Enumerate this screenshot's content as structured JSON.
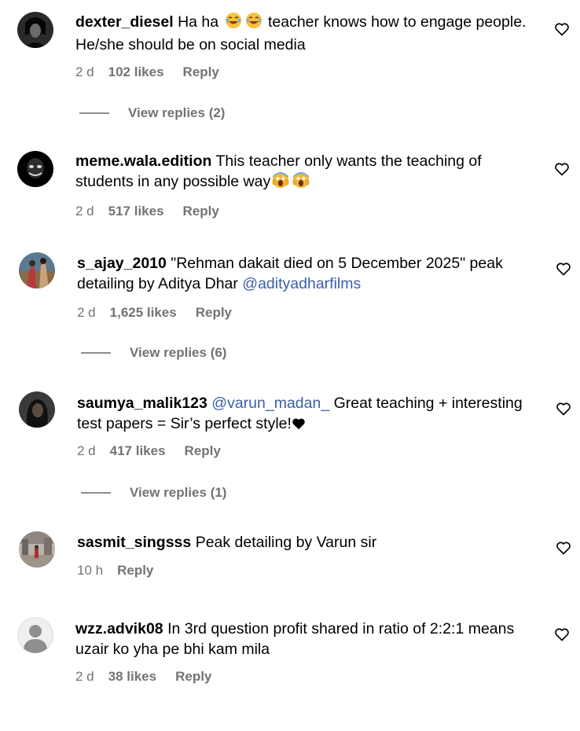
{
  "comments": [
    {
      "username": "dexter_diesel",
      "text": "Ha ha",
      "text_after_emoji": "teacher knows how to engage people. He/she should be on social media",
      "time": "2 d",
      "likes": "102 likes",
      "reply": "Reply",
      "view_replies": "View replies (2)",
      "avatar_icon": "dark-portrait-avatar"
    },
    {
      "username": "meme.wala.edition",
      "text": "This teacher only wants the teaching of students in any possible way",
      "time": "2 d",
      "likes": "517 likes",
      "reply": "Reply",
      "avatar_icon": "mask-face-avatar"
    },
    {
      "username": "s_ajay_2010",
      "text": "\"Rehman dakait died on 5 December 2025\" peak detailing by Aditya Dhar",
      "mention": "@adityadharfilms",
      "time": "2 d",
      "likes": "1,625 likes",
      "reply": "Reply",
      "view_replies": "View replies (6)",
      "avatar_icon": "colorful-scene-avatar"
    },
    {
      "username": "saumya_malik123",
      "mention": "@varun_madan_",
      "text": "Great teaching + interesting test papers = Sir’s perfect style!",
      "time": "2 d",
      "likes": "417 likes",
      "reply": "Reply",
      "view_replies": "View replies (1)",
      "avatar_icon": "dark-portrait-avatar"
    },
    {
      "username": "sasmit_singsss",
      "text": "Peak detailing by Varun sir",
      "time": "10 h",
      "reply": "Reply",
      "avatar_icon": "outdoor-scene-avatar"
    },
    {
      "username": "wzz.advik08",
      "text": "In 3rd question profit shared in ratio of 2:2:1 means uzair ko yha pe bhi kam mila",
      "time": "2 d",
      "likes": "38 likes",
      "reply": "Reply",
      "avatar_icon": "default-user-avatar"
    }
  ],
  "icons": {
    "like": "heart-outline-icon",
    "emoji_laugh": "laughing-emoji",
    "emoji_scream": "screaming-emoji",
    "heart_black": "black-heart-emoji"
  },
  "colors": {
    "mention": "#3b5fa8",
    "meta": "#737373"
  }
}
